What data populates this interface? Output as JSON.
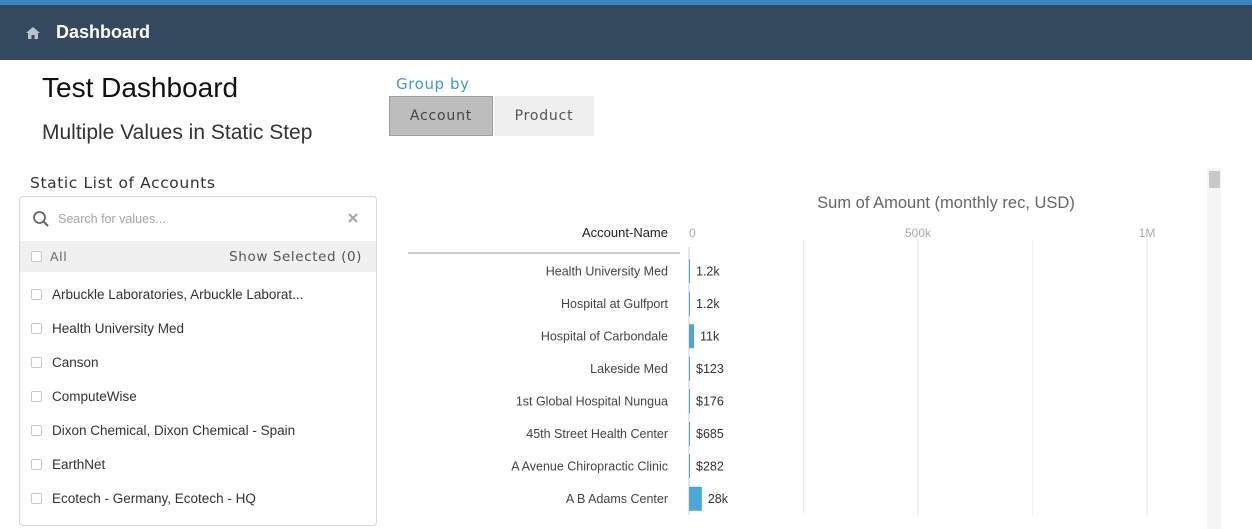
{
  "topbar": {
    "title": "Dashboard",
    "icon": "home-icon"
  },
  "page": {
    "title": "Test Dashboard",
    "subtitle": "Multiple Values in Static Step"
  },
  "group_by": {
    "label": "Group by",
    "options": [
      {
        "label": "Account",
        "selected": true
      },
      {
        "label": "Product",
        "selected": false
      }
    ]
  },
  "accounts_panel": {
    "title": "Static List of Accounts",
    "search_placeholder": "Search for values...",
    "all_label": "All",
    "show_selected_label": "Show Selected (0)",
    "items": [
      "Arbuckle Laboratories, Arbuckle Laborat...",
      "Health University Med",
      "Canson",
      "ComputeWise",
      "Dixon Chemical, Dixon Chemical - Spain",
      "EarthNet",
      "Ecotech - Germany, Ecotech - HQ"
    ]
  },
  "chart_data": {
    "type": "bar",
    "orientation": "horizontal",
    "title": "Sum of Amount (monthly rec, USD)",
    "category_label": "Account-Name",
    "tick_labels": [
      "0",
      "500k",
      "1M"
    ],
    "x_ticks": [
      0,
      500000,
      1000000
    ],
    "xlim": [
      0,
      1000000
    ],
    "categories": [
      "Health University Med",
      "Hospital at Gulfport",
      "Hospital of Carbondale",
      "Lakeside Med",
      "1st Global Hospital Nungua",
      "45th Street  Health Center",
      "A Avenue Chiropractic Clinic",
      "A B Adams  Center"
    ],
    "values": [
      1200,
      1200,
      11000,
      123,
      176,
      685,
      282,
      28000
    ],
    "data_labels": [
      "1.2k",
      "1.2k",
      "11k",
      "$123",
      "$176",
      "$685",
      "$282",
      "28k"
    ],
    "bar_color": "#4aa8d8",
    "grid": true
  },
  "colors": {
    "topbar": "#34495e",
    "accent": "#3a9bd5",
    "bar": "#4aa8d8"
  }
}
